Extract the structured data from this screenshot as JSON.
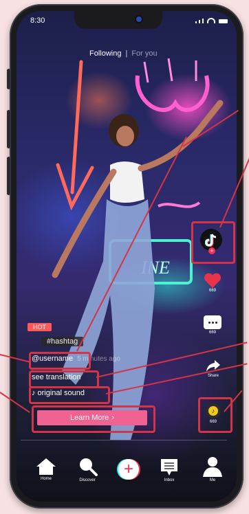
{
  "status_bar": {
    "time": "8:30"
  },
  "feed_tabs": {
    "following": "Following",
    "separator": "|",
    "for_you": "For you"
  },
  "post": {
    "badge": "HOT",
    "hashtag": "#hashtag",
    "username": "@username",
    "time_ago": "5 minutes ago",
    "see_translation": "see translation",
    "sound_icon": "music-note-icon",
    "sound": "original sound",
    "cta_label": "Learn More",
    "cta_chevron": "›"
  },
  "actions": {
    "likes": "669",
    "comments": "669",
    "share": "Share",
    "sound_count": "669"
  },
  "nav": {
    "home": "Home",
    "discover": "Discover",
    "create": "+",
    "inbox": "Inbox",
    "me": "Me"
  },
  "colors": {
    "accent_pink": "#f06292",
    "annotation_red": "#d23548",
    "like_red": "#e8334a",
    "hot_red": "#ff5a5a"
  }
}
